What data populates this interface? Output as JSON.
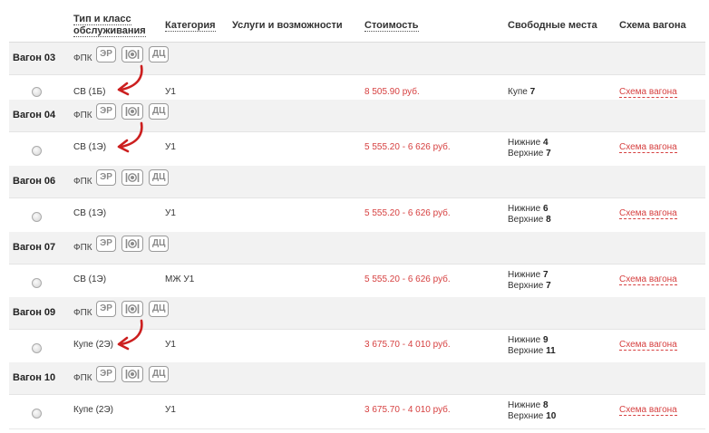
{
  "header": {
    "type_line1": "Тип и класс",
    "type_line2": "обслуживания",
    "category": "Категория",
    "services": "Услуги и возможности",
    "cost": "Стоимость",
    "free_seats": "Свободные места",
    "scheme": "Схема вагона"
  },
  "badges": {
    "er": "ЭР",
    "dc": "ДЦ",
    "meal_icon": "meal-icon"
  },
  "colors": {
    "price": "#d64040",
    "arrow": "#cc1f1f",
    "group_bg": "#f2f2f2"
  },
  "cars": [
    {
      "car": "Вагон 03",
      "carrier": "ФПК",
      "class": "СВ (1Б)",
      "category": "У1",
      "price": "8 505.90 руб.",
      "seat_lines": [
        {
          "label": "Купе",
          "count": "7"
        }
      ],
      "scheme": "Схема вагона",
      "arrow": true
    },
    {
      "car": "Вагон 04",
      "carrier": "ФПК",
      "class": "СВ (1Э)",
      "category": "У1",
      "price": "5 555.20 - 6 626 руб.",
      "seat_lines": [
        {
          "label": "Нижние",
          "count": "4"
        },
        {
          "label": "Верхние",
          "count": "7"
        }
      ],
      "scheme": "Схема вагона",
      "arrow": true
    },
    {
      "car": "Вагон 06",
      "carrier": "ФПК",
      "class": "СВ (1Э)",
      "category": "У1",
      "price": "5 555.20 - 6 626 руб.",
      "seat_lines": [
        {
          "label": "Нижние",
          "count": "6"
        },
        {
          "label": "Верхние",
          "count": "8"
        }
      ],
      "scheme": "Схема вагона",
      "arrow": false
    },
    {
      "car": "Вагон 07",
      "carrier": "ФПК",
      "class": "СВ (1Э)",
      "category": "МЖ У1",
      "price": "5 555.20 - 6 626 руб.",
      "seat_lines": [
        {
          "label": "Нижние",
          "count": "7"
        },
        {
          "label": "Верхние",
          "count": "7"
        }
      ],
      "scheme": "Схема вагона",
      "arrow": false
    },
    {
      "car": "Вагон 09",
      "carrier": "ФПК",
      "class": "Купе (2Э)",
      "category": "У1",
      "price": "3 675.70 - 4 010 руб.",
      "seat_lines": [
        {
          "label": "Нижние",
          "count": "9"
        },
        {
          "label": "Верхние",
          "count": "11"
        }
      ],
      "scheme": "Схема вагона",
      "arrow": true
    },
    {
      "car": "Вагон 10",
      "carrier": "ФПК",
      "class": "Купе (2Э)",
      "category": "У1",
      "price": "3 675.70 - 4 010 руб.",
      "seat_lines": [
        {
          "label": "Нижние",
          "count": "8"
        },
        {
          "label": "Верхние",
          "count": "10"
        }
      ],
      "scheme": "Схема вагона",
      "arrow": false
    }
  ]
}
